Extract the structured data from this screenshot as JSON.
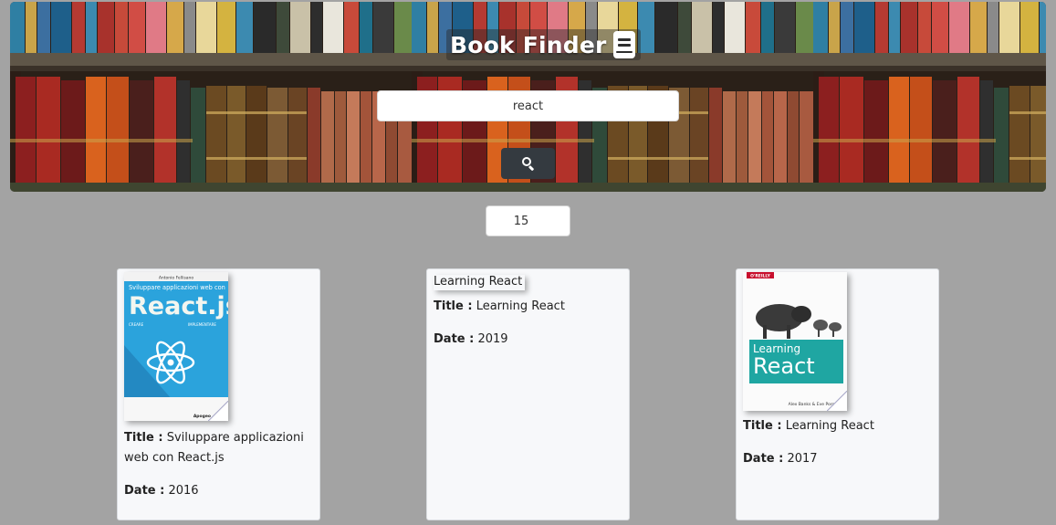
{
  "header": {
    "title": "Book Finder",
    "icon": "book-icon"
  },
  "search": {
    "value": "react",
    "button_icon": "search-icon"
  },
  "results_count": "15",
  "labels": {
    "title": "Title :",
    "date": "Date :"
  },
  "books": [
    {
      "title": "Sviluppare applicazioni web con React.js",
      "date": "2016",
      "cover": {
        "author": "Antonio Fellisano",
        "heading": "Sviluppare applicazioni web con",
        "big": "React.js",
        "left_col": "CREARE",
        "right_col": "IMPLEMENTARE",
        "publisher": "Apogeo"
      }
    },
    {
      "title": "Learning React",
      "date": "2019",
      "image_alt": "Learning React"
    },
    {
      "title": "Learning React",
      "date": "2017",
      "cover": {
        "publisher": "O'REILLY",
        "line1": "Learning",
        "line2": "React",
        "authors": "Alex Banks & Eve Porcello"
      }
    }
  ],
  "colors": {
    "page_bg": "#a3a3a3",
    "search_button": "#343a40",
    "card_bg": "#f7f8fa"
  }
}
